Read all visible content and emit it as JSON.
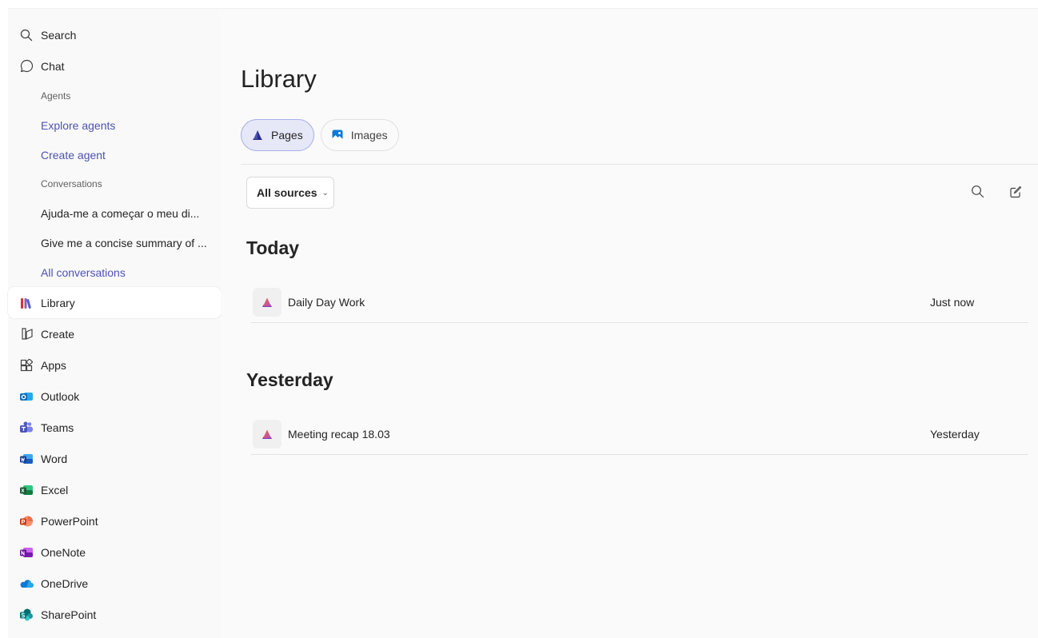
{
  "sidebar": {
    "search": "Search",
    "chat": "Chat",
    "agents_label": "Agents",
    "explore_agents": "Explore agents",
    "create_agent": "Create agent",
    "conversations_label": "Conversations",
    "conversations": [
      "Ajuda-me a começar o meu di...",
      "Give me a concise summary of ..."
    ],
    "all_conversations": "All conversations",
    "library": "Library",
    "create": "Create",
    "apps": "Apps",
    "apps_list": [
      "Outlook",
      "Teams",
      "Word",
      "Excel",
      "PowerPoint",
      "OneNote",
      "OneDrive",
      "SharePoint"
    ]
  },
  "main": {
    "title": "Library",
    "tabs": [
      {
        "label": "Pages",
        "selected": true
      },
      {
        "label": "Images",
        "selected": false
      }
    ],
    "filter_label": "All sources",
    "groups": [
      {
        "heading": "Today",
        "items": [
          {
            "name": "Daily Day Work",
            "when": "Just now"
          }
        ]
      },
      {
        "heading": "Yesterday",
        "items": [
          {
            "name": "Meeting recap 18.03",
            "when": "Yesterday"
          }
        ]
      }
    ]
  },
  "colors": {
    "accent": "#4f52b2",
    "selected_tab_bg": "#e6e8f7",
    "sidebar_bg": "#f9f9f9"
  },
  "icons": {
    "search": "search-icon",
    "chat": "chat-bubble-icon",
    "library": "library-books-icon",
    "create": "create-icon",
    "apps": "apps-grid-icon",
    "new_page": "compose-icon"
  }
}
